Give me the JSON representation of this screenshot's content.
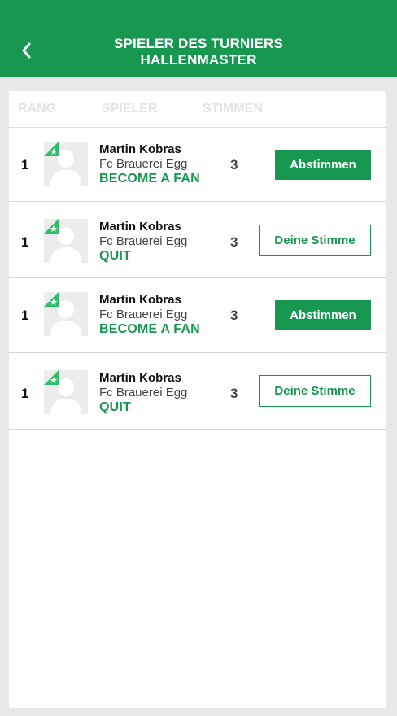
{
  "header": {
    "title_line1": "SPIELER DES TURNIERS",
    "title_line2": "HALLENMASTER"
  },
  "table": {
    "col_rank": "RANG",
    "col_player": "SPIELER",
    "col_votes": "STIMMEN"
  },
  "rows": [
    {
      "rank": "1",
      "name": "Martin Kobras",
      "club": "Fc Brauerei Egg",
      "fan_action": "BECOME A FAN",
      "votes": "3",
      "button": "Abstimmen"
    },
    {
      "rank": "1",
      "name": "Martin Kobras",
      "club": "Fc Brauerei Egg",
      "fan_action": "QUIT",
      "votes": "3",
      "button": "Deine Stimme"
    },
    {
      "rank": "1",
      "name": "Martin Kobras",
      "club": "Fc Brauerei Egg",
      "fan_action": "BECOME A FAN",
      "votes": "3",
      "button": "Abstimmen"
    },
    {
      "rank": "1",
      "name": "Martin Kobras",
      "club": "Fc Brauerei Egg",
      "fan_action": "QUIT",
      "votes": "3",
      "button": "Deine Stimme"
    }
  ],
  "colors": {
    "brand": "#17974f",
    "background": "#e8e8ea"
  }
}
